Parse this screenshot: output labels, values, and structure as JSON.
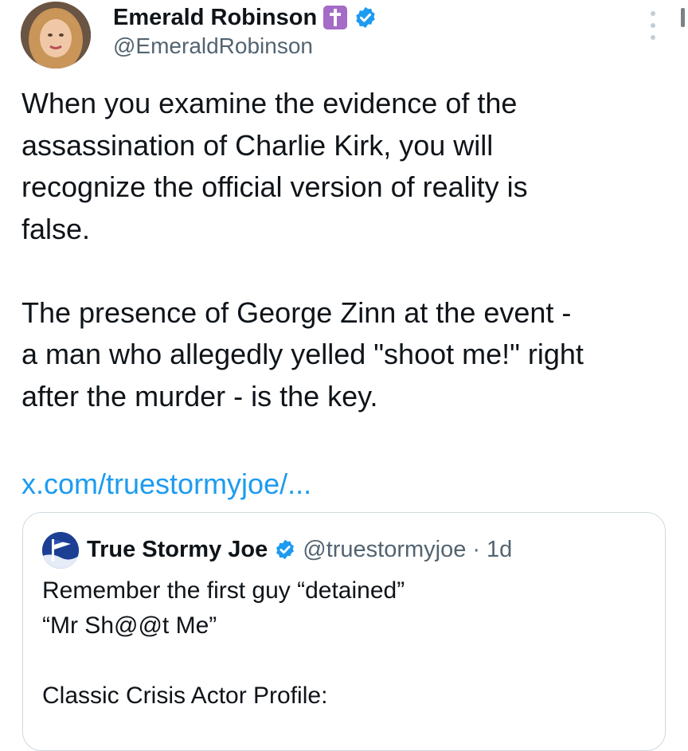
{
  "post": {
    "author": {
      "display_name": "Emerald Robinson",
      "emoji": "latin-cross-emoji",
      "handle": "@EmeraldRobinson",
      "verified": true
    },
    "text": {
      "line1": "When you examine the evidence of the",
      "line2": "assassination of Charlie Kirk, you will",
      "line3": "recognize the official version of reality is",
      "line4": "false.",
      "line5": "The presence of George Zinn at the event -",
      "line6": "a man who allegedly yelled \"shoot me!\" right",
      "line7": "after the murder - is the key."
    },
    "link": "x.com/truestormyjoe/..."
  },
  "quote": {
    "author": {
      "display_name": "True Stormy Joe",
      "handle": "@truestormyjoe",
      "separator": "·",
      "time": "1d",
      "verified": true
    },
    "text": {
      "line1": "Remember the first guy “detained”",
      "line2": "“Mr Sh@@t Me”",
      "line3": "Classic Crisis Actor Profile:"
    }
  },
  "colors": {
    "text": "#0f1419",
    "secondary_text": "#536471",
    "link": "#1d9bf0",
    "verified": "#1d9bf0",
    "border": "#cfd9de",
    "emoji_background": "#a46bc7"
  }
}
